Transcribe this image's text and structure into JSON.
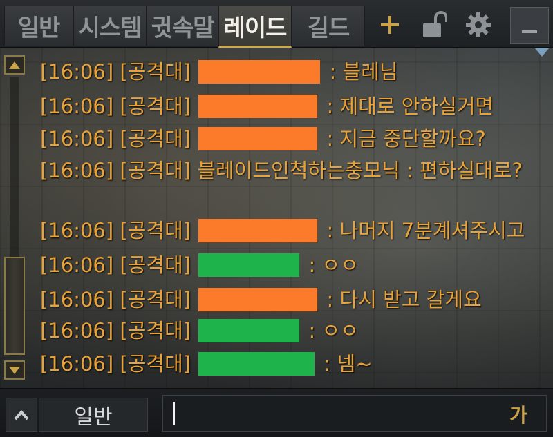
{
  "tabs": [
    {
      "label": "일반"
    },
    {
      "label": "시스템"
    },
    {
      "label": "귓속말"
    },
    {
      "label": "레이드"
    },
    {
      "label": "길드"
    }
  ],
  "toolbar": {
    "add_icon": "plus-icon",
    "lock_icon": "unlock-icon",
    "settings_icon": "gear-icon",
    "minimize_icon": "minimize-icon"
  },
  "colors": {
    "message_text": "#e8a23a",
    "redaction_orange": "#fb7b2a",
    "redaction_green": "#1fb34c",
    "active_tab_underline": "#cfa84a"
  },
  "messages": [
    {
      "time": "[16:06]",
      "channel": "[공격대]",
      "redaction": "orange",
      "text": ": 블레님"
    },
    {
      "time": "[16:06]",
      "channel": "[공격대]",
      "redaction": "orange",
      "text": ": 제대로 안하실거면"
    },
    {
      "time": "[16:06]",
      "channel": "[공격대]",
      "redaction": "orange",
      "text": ": 지금 중단할까요?"
    },
    {
      "time": "[16:06]",
      "channel": "[공격대]",
      "sender": "블레이드인척하는충모닉",
      "text": ": 편하실대로?"
    },
    {
      "time": "[16:06]",
      "channel": "[공격대]",
      "redaction": "orange",
      "text": ": 나머지 7분계셔주시고"
    },
    {
      "time": "[16:06]",
      "channel": "[공격대]",
      "redaction": "green",
      "text": ": ㅇㅇ"
    },
    {
      "time": "[16:06]",
      "channel": "[공격대]",
      "redaction": "orange",
      "text": ": 다시 받고 갈게요"
    },
    {
      "time": "[16:06]",
      "channel": "[공격대]",
      "redaction": "green",
      "text": ": ㅇㅇ"
    },
    {
      "time": "[16:06]",
      "channel": "[공격대]",
      "redaction": "green",
      "text": ": 넴~"
    }
  ],
  "input": {
    "channel_label": "일반",
    "value": "",
    "ime_label": "가"
  }
}
